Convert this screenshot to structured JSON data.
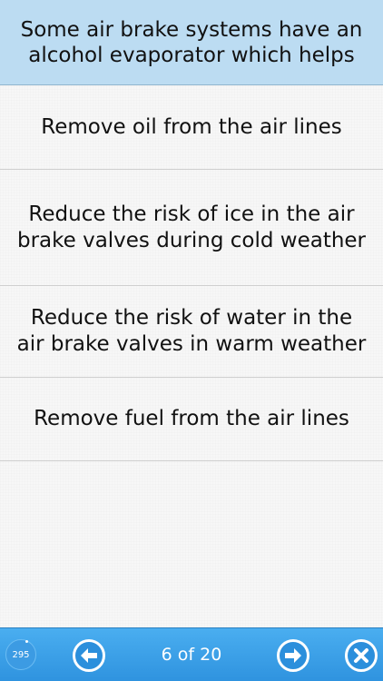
{
  "question": {
    "text": "Some air brake systems have an alcohol evaporator which helps"
  },
  "answers": [
    {
      "label": "Remove oil from the air lines"
    },
    {
      "label": "Reduce the risk of ice in the air brake valves during cold weather"
    },
    {
      "label": "Reduce the risk of water in the air brake valves in warm weather"
    },
    {
      "label": "Remove fuel from the air lines"
    }
  ],
  "toolbar": {
    "counter": "295",
    "page_indicator": "6 of 20",
    "prev_icon": "left-arrow-icon",
    "next_icon": "right-arrow-icon",
    "close_icon": "close-icon",
    "accent_color": "#3a9fe6"
  },
  "colors": {
    "question_bg": "#bcdcf2",
    "toolbar_bg": "#3a9fe6"
  }
}
